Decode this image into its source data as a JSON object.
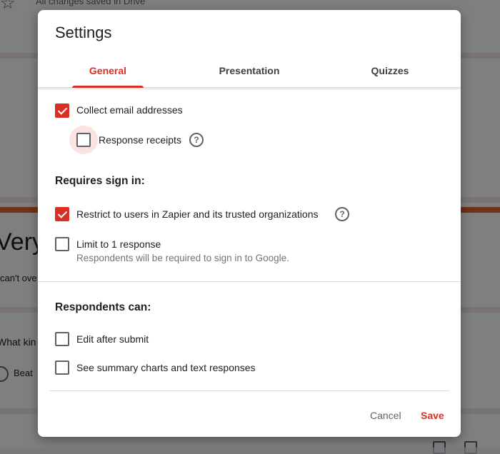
{
  "background": {
    "status_text": "All changes saved in Drive",
    "form_title_partial": "Very",
    "form_subtitle_partial": "can't ove",
    "question_partial": "What kin",
    "option_partial": "Beat"
  },
  "dialog": {
    "title": "Settings",
    "tabs": [
      {
        "label": "General",
        "active": true
      },
      {
        "label": "Presentation",
        "active": false
      },
      {
        "label": "Quizzes",
        "active": false
      }
    ],
    "general": {
      "collect_email": {
        "label": "Collect email addresses",
        "checked": true
      },
      "response_receipts": {
        "label": "Response receipts",
        "checked": false
      },
      "requires_sign_in_title": "Requires sign in:",
      "restrict_users": {
        "label": "Restrict to users in Zapier and its trusted organizations",
        "checked": true
      },
      "limit_one": {
        "label": "Limit to 1 response",
        "hint": "Respondents will be required to sign in to Google.",
        "checked": false
      },
      "respondents_can_title": "Respondents can:",
      "edit_after_submit": {
        "label": "Edit after submit",
        "checked": false
      },
      "see_summary": {
        "label": "See summary charts and text responses",
        "checked": false
      }
    },
    "actions": {
      "cancel": "Cancel",
      "save": "Save"
    },
    "help_icon_glyph": "?"
  },
  "colors": {
    "accent": "#d93025",
    "halo": "#fbe3e1"
  }
}
